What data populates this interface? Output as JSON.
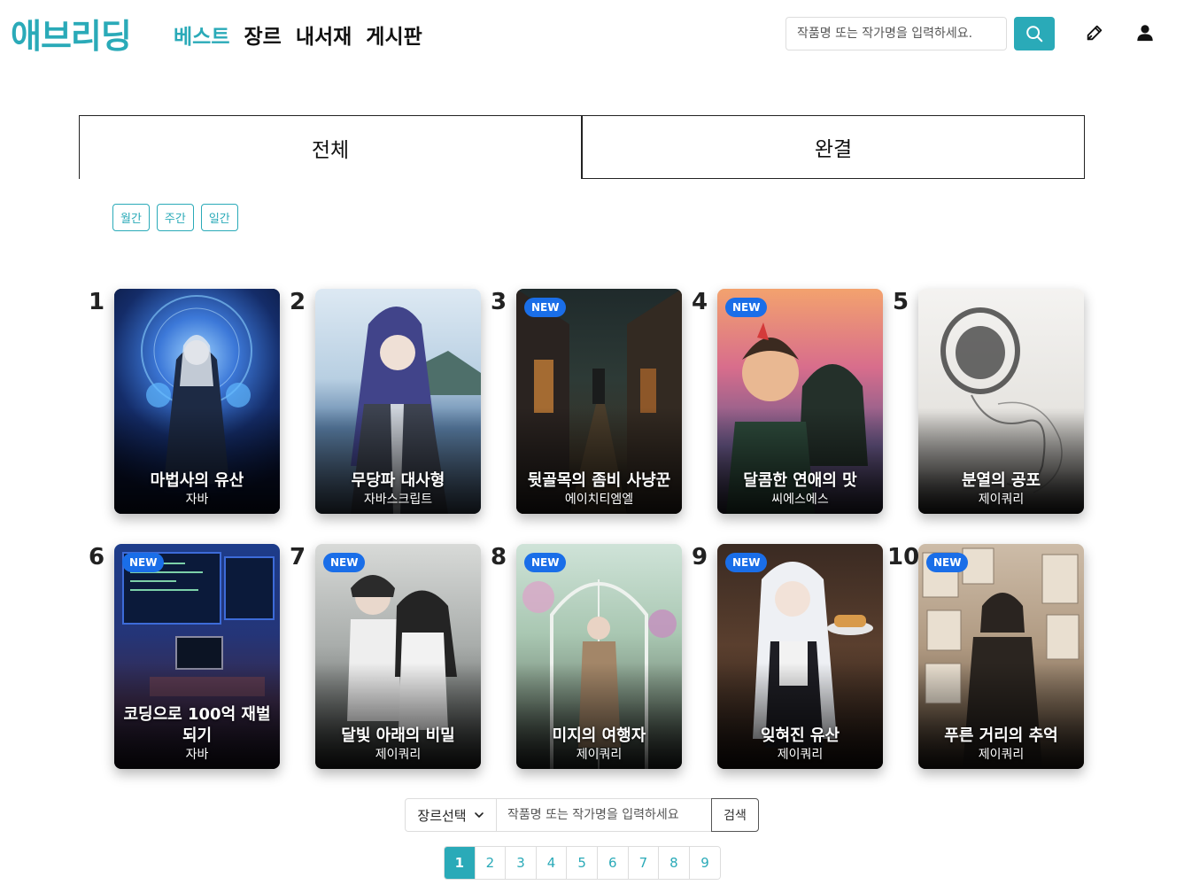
{
  "header": {
    "logo": "애브리딩",
    "nav": [
      {
        "label": "베스트",
        "active": true
      },
      {
        "label": "장르",
        "active": false
      },
      {
        "label": "내서재",
        "active": false
      },
      {
        "label": "게시판",
        "active": false
      }
    ],
    "search_placeholder": "작품명 또는 작가명을 입력하세요.",
    "search_icon": "search-icon",
    "write_icon": "pen-icon",
    "user_icon": "user-icon",
    "accent_color": "#2aaab8"
  },
  "tabs": {
    "all": "전체",
    "completed": "완결"
  },
  "periods": [
    "월간",
    "주간",
    "일간"
  ],
  "works": [
    {
      "rank": "1",
      "title": "마법사의 유산",
      "author": "자바",
      "is_new": false
    },
    {
      "rank": "2",
      "title": "무당파 대사형",
      "author": "자바스크립트",
      "is_new": false
    },
    {
      "rank": "3",
      "title": "뒷골목의 좀비 사냥꾼",
      "author": "에이치티엠엘",
      "is_new": true
    },
    {
      "rank": "4",
      "title": "달콤한 연애의 맛",
      "author": "씨에스에스",
      "is_new": true
    },
    {
      "rank": "5",
      "title": "분열의 공포",
      "author": "제이쿼리",
      "is_new": false
    },
    {
      "rank": "6",
      "title": "코딩으로 100억 재벌 되기",
      "author": "자바",
      "is_new": true
    },
    {
      "rank": "7",
      "title": "달빛 아래의 비밀",
      "author": "제이쿼리",
      "is_new": true
    },
    {
      "rank": "8",
      "title": "미지의 여행자",
      "author": "제이쿼리",
      "is_new": true
    },
    {
      "rank": "9",
      "title": "잊혀진 유산",
      "author": "제이쿼리",
      "is_new": true
    },
    {
      "rank": "10",
      "title": "푸른 거리의 추억",
      "author": "제이쿼리",
      "is_new": true
    }
  ],
  "new_badge": "NEW",
  "bottom_search": {
    "genre_label": "장르선택",
    "placeholder": "작품명 또는 작가명을 입력하세요",
    "button": "검색"
  },
  "pagination": {
    "pages": [
      "1",
      "2",
      "3",
      "4",
      "5",
      "6",
      "7",
      "8",
      "9"
    ],
    "current": "1"
  }
}
